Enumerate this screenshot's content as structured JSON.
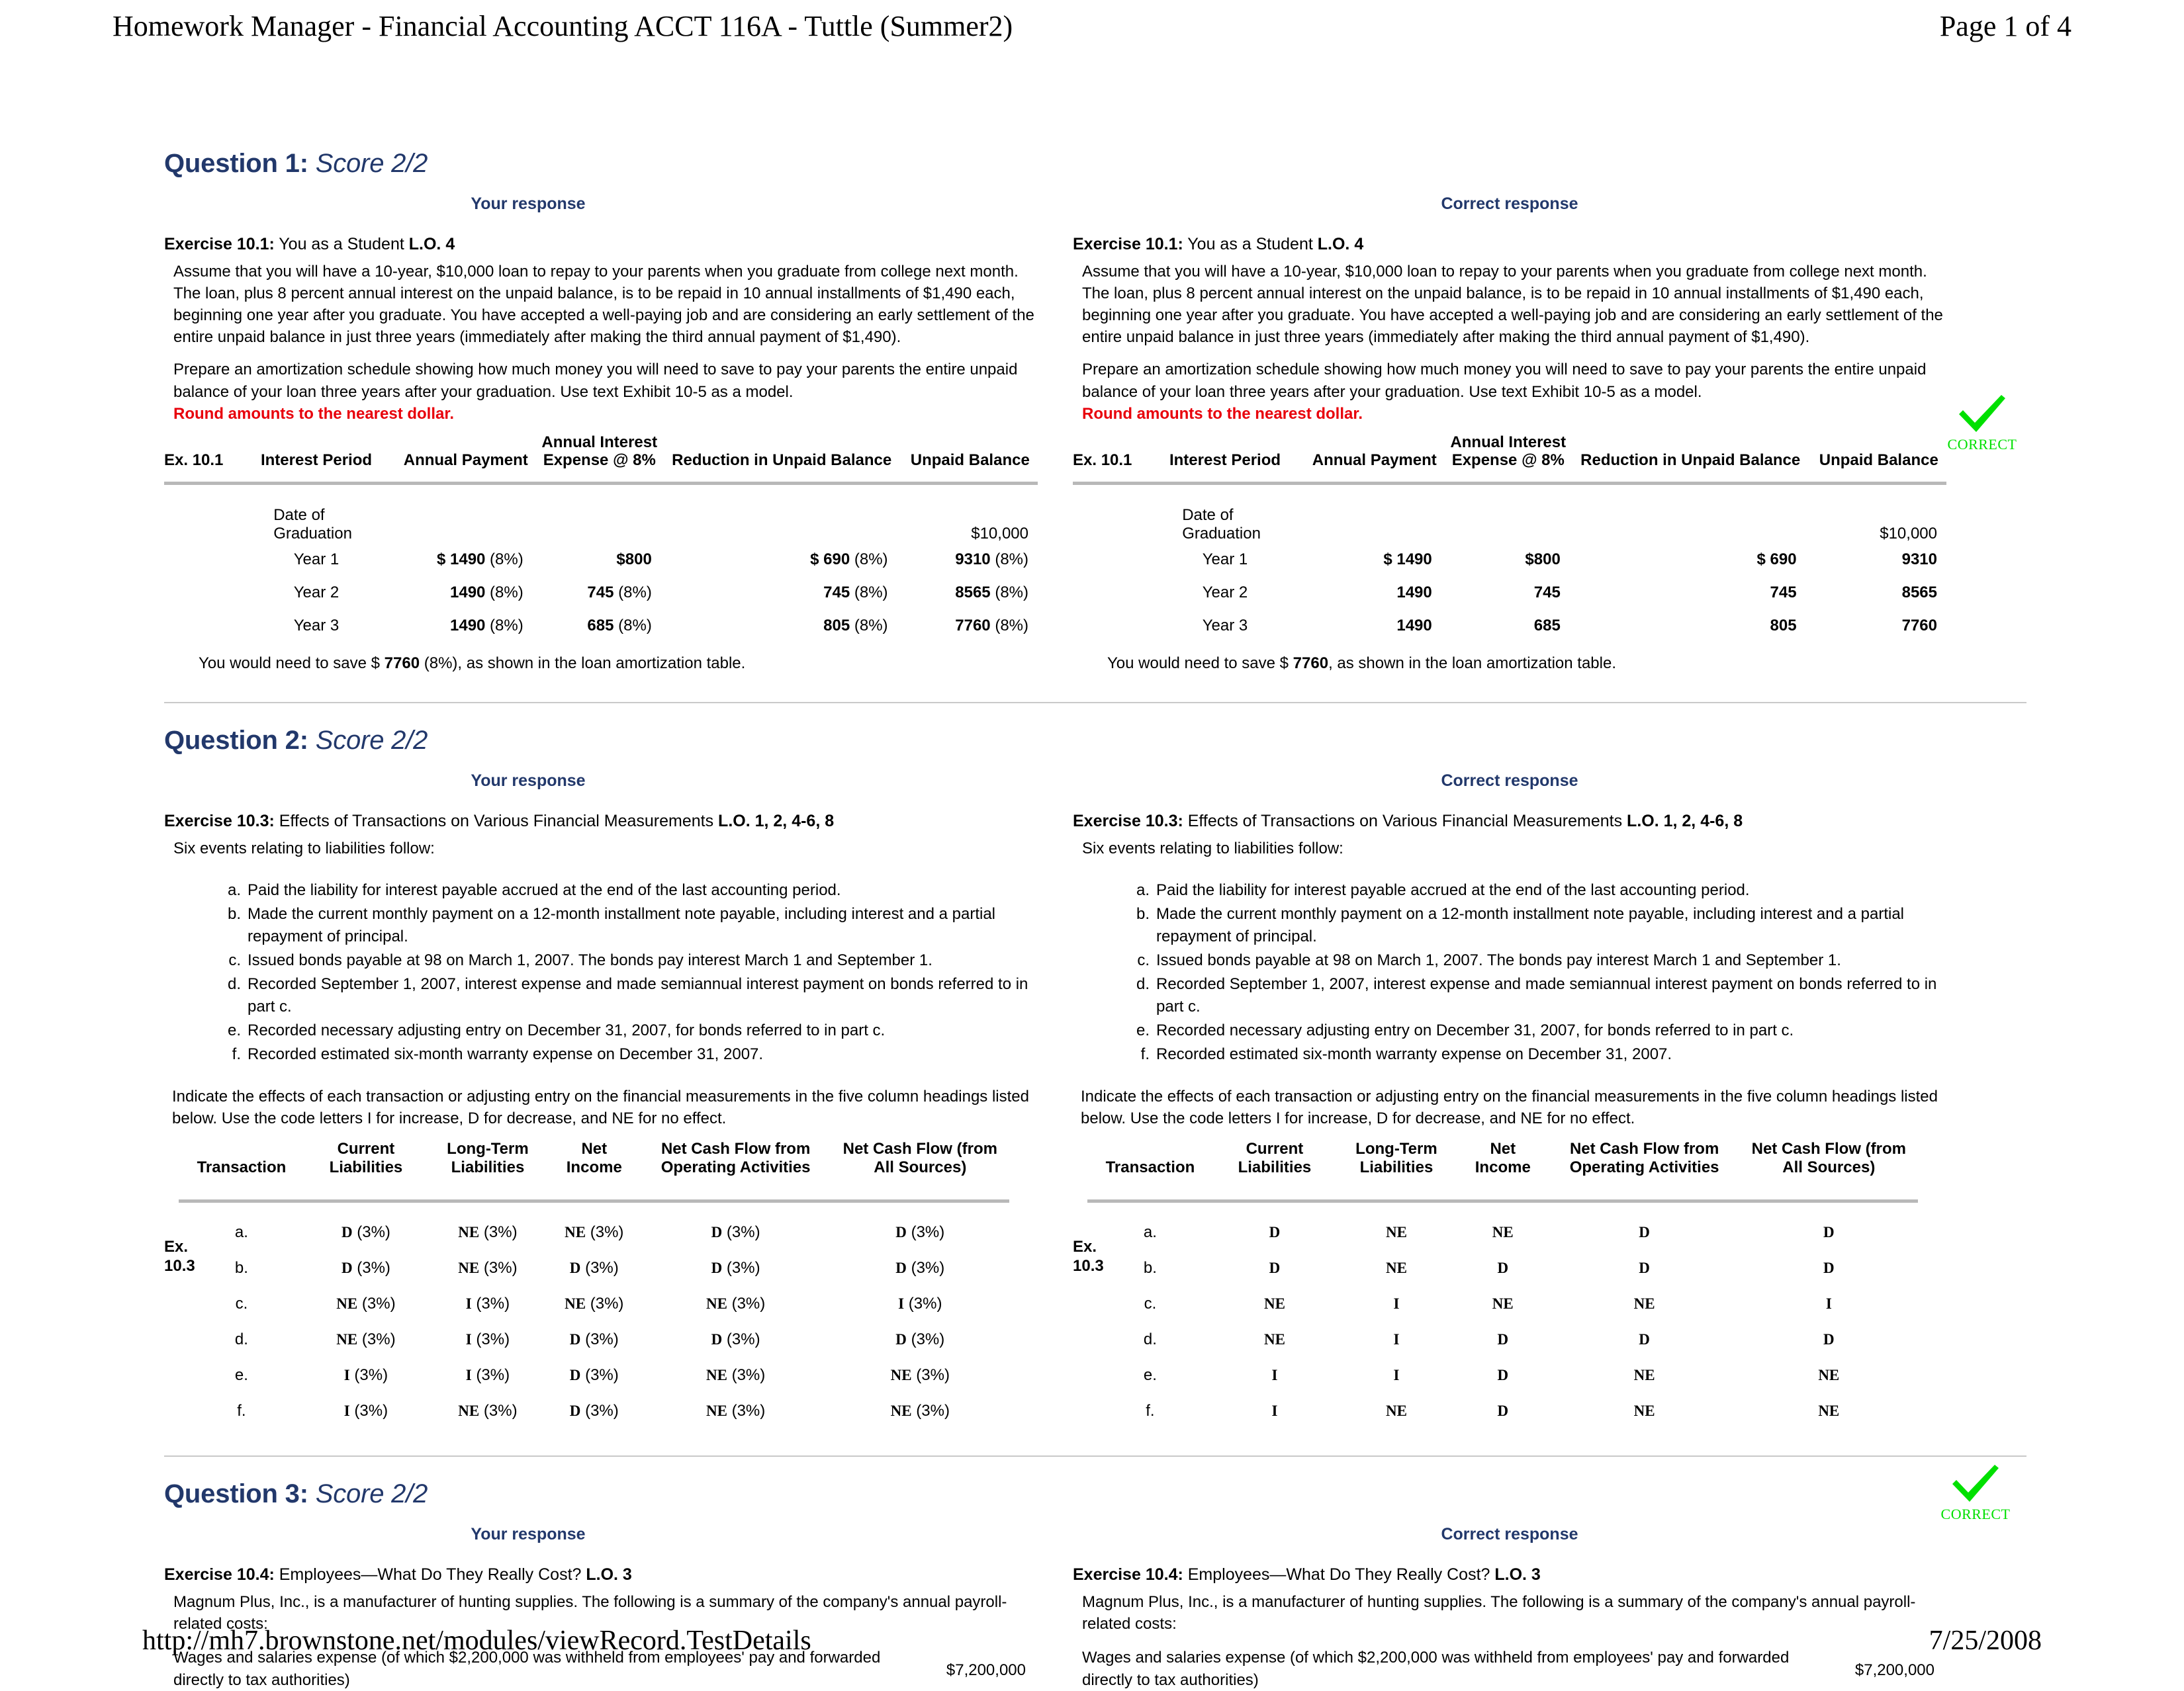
{
  "header": {
    "title": "Homework Manager - Financial Accounting ACCT 116A - Tuttle (Summer2)",
    "page_label": "Page 1 of 4"
  },
  "footer": {
    "url": "http://mh7.brownstone.net/modules/viewRecord.TestDetails",
    "date": "7/25/2008"
  },
  "labels": {
    "your_response": "Your response",
    "correct_response": "Correct response",
    "correct_badge": "CORRECT",
    "check_color": "#00e000",
    "heading_color": "#22386b",
    "alert_color": "#e8000b"
  },
  "questions": [
    {
      "number": "Question 1:",
      "score": "Score 2/2",
      "exercise_label": "Exercise 10.1:",
      "exercise_title": "You as a Student",
      "lo": "L.O. 4",
      "paragraphs": [
        "Assume that you will have a 10-year, $10,000 loan to repay to your parents when you graduate from college next month. The loan, plus 8 percent annual interest on the unpaid balance, is to be repaid in 10 annual installments of $1,490 each, beginning one year after you graduate. You have accepted a well-paying job and are considering an early settlement of the entire unpaid balance in just three years (immediately after making the third annual payment of $1,490).",
        "Prepare an amortization schedule showing how much money you will need to save to pay your parents the entire unpaid balance of your loan three years after your graduation. Use text Exhibit 10-5 as a model."
      ],
      "alert": "Round amounts to the nearest dollar.",
      "table": {
        "headers": {
          "ex": "Ex. 10.1",
          "period": "Interest Period",
          "payment": "Annual Payment",
          "interest_l1": "Annual Interest",
          "interest_l2": "Expense @ 8%",
          "reduction": "Reduction in Unpaid Balance",
          "balance": "Unpaid Balance"
        },
        "graduation_row": {
          "period": "Date of Graduation",
          "balance": "$10,000"
        },
        "rows_response": [
          {
            "period": "Year 1",
            "payment": "$ 1490",
            "payment_pct": " (8%)",
            "interest": "$800",
            "interest_pct": "",
            "reduction": "$ 690",
            "reduction_pct": " (8%)",
            "balance": "9310",
            "balance_pct": " (8%)"
          },
          {
            "period": "Year 2",
            "payment": "1490",
            "payment_pct": " (8%)",
            "interest": "745",
            "interest_pct": " (8%)",
            "reduction": "745",
            "reduction_pct": " (8%)",
            "balance": "8565",
            "balance_pct": " (8%)"
          },
          {
            "period": "Year 3",
            "payment": "1490",
            "payment_pct": " (8%)",
            "interest": "685",
            "interest_pct": " (8%)",
            "reduction": "805",
            "reduction_pct": " (8%)",
            "balance": "7760",
            "balance_pct": " (8%)"
          }
        ],
        "rows_correct": [
          {
            "period": "Year 1",
            "payment": "$ 1490",
            "payment_pct": "",
            "interest": "$800",
            "interest_pct": "",
            "reduction": "$ 690",
            "reduction_pct": "",
            "balance": "9310",
            "balance_pct": ""
          },
          {
            "period": "Year 2",
            "payment": "1490",
            "payment_pct": "",
            "interest": "745",
            "interest_pct": "",
            "reduction": "745",
            "reduction_pct": "",
            "balance": "8565",
            "balance_pct": ""
          },
          {
            "period": "Year 3",
            "payment": "1490",
            "payment_pct": "",
            "interest": "685",
            "interest_pct": "",
            "reduction": "805",
            "reduction_pct": "",
            "balance": "7760",
            "balance_pct": ""
          }
        ],
        "closing_response_a": "You would need to save $ ",
        "closing_response_amount": "7760",
        "closing_response_pct": " (8%)",
        "closing_response_b": ", as shown in the loan amortization table.",
        "closing_correct_pct": ""
      }
    },
    {
      "number": "Question 2:",
      "score": "Score 2/2",
      "exercise_label": "Exercise 10.3:",
      "exercise_title": "Effects of Transactions on Various Financial Measurements",
      "lo": "L.O. 1, 2, 4-6, 8",
      "lead": "Six events relating to liabilities follow:",
      "events": [
        {
          "mark": "a.",
          "text": "Paid the liability for interest payable accrued at the end of the last accounting period."
        },
        {
          "mark": "b.",
          "text": "Made the current monthly payment on a 12-month installment note payable, including interest and a partial repayment of principal."
        },
        {
          "mark": "c.",
          "text": "Issued bonds payable at 98 on March 1, 2007. The bonds pay interest March 1 and September 1."
        },
        {
          "mark": "d.",
          "text": "Recorded September 1, 2007, interest expense and made semiannual interest payment on bonds referred to in part c."
        },
        {
          "mark": "e.",
          "text": "Recorded necessary adjusting entry on December 31, 2007, for bonds referred to in part c."
        },
        {
          "mark": "f.",
          "text": "Recorded estimated six-month warranty expense on December 31, 2007."
        }
      ],
      "instruction": "Indicate the effects of each transaction or adjusting entry on the financial measurements in the five column headings listed below. Use the code letters I for increase, D for decrease, and NE for no effect.",
      "table": {
        "ex_label_l1": "Ex.",
        "ex_label_l2": "10.3",
        "headers": {
          "transaction": "Transaction",
          "current_l1": "Current",
          "current_l2": "Liabilities",
          "longterm_l1": "Long-Term",
          "longterm_l2": "Liabilities",
          "net_l1": "Net",
          "net_l2": "Income",
          "cfo_l1": "Net Cash Flow from",
          "cfo_l2": "Operating Activities",
          "cfa_l1": "Net Cash Flow (from",
          "cfa_l2": "All Sources)"
        },
        "pct": " (3%)",
        "rows": [
          {
            "tx": "a.",
            "cl": "D",
            "lt": "NE",
            "ni": "NE",
            "cfo": "D",
            "cfa": "D"
          },
          {
            "tx": "b.",
            "cl": "D",
            "lt": "NE",
            "ni": "D",
            "cfo": "D",
            "cfa": "D"
          },
          {
            "tx": "c.",
            "cl": "NE",
            "lt": "I",
            "ni": "NE",
            "cfo": "NE",
            "cfa": "I"
          },
          {
            "tx": "d.",
            "cl": "NE",
            "lt": "I",
            "ni": "D",
            "cfo": "D",
            "cfa": "D"
          },
          {
            "tx": "e.",
            "cl": "I",
            "lt": "I",
            "ni": "D",
            "cfo": "NE",
            "cfa": "NE"
          },
          {
            "tx": "f.",
            "cl": "I",
            "lt": "NE",
            "ni": "D",
            "cfo": "NE",
            "cfa": "NE"
          }
        ]
      }
    },
    {
      "number": "Question 3:",
      "score": "Score 2/2",
      "exercise_label": "Exercise 10.4:",
      "exercise_title": "Employees—What Do They Really Cost?",
      "lo": "L.O. 3",
      "intro": "Magnum Plus, Inc., is a manufacturer of hunting supplies. The following is a summary of the company's annual payroll-related costs:",
      "line_item": {
        "desc": "Wages and salaries expense (of which $2,200,000 was withheld from employees' pay and forwarded directly to tax authorities)",
        "amount": "$7,200,000"
      }
    }
  ]
}
